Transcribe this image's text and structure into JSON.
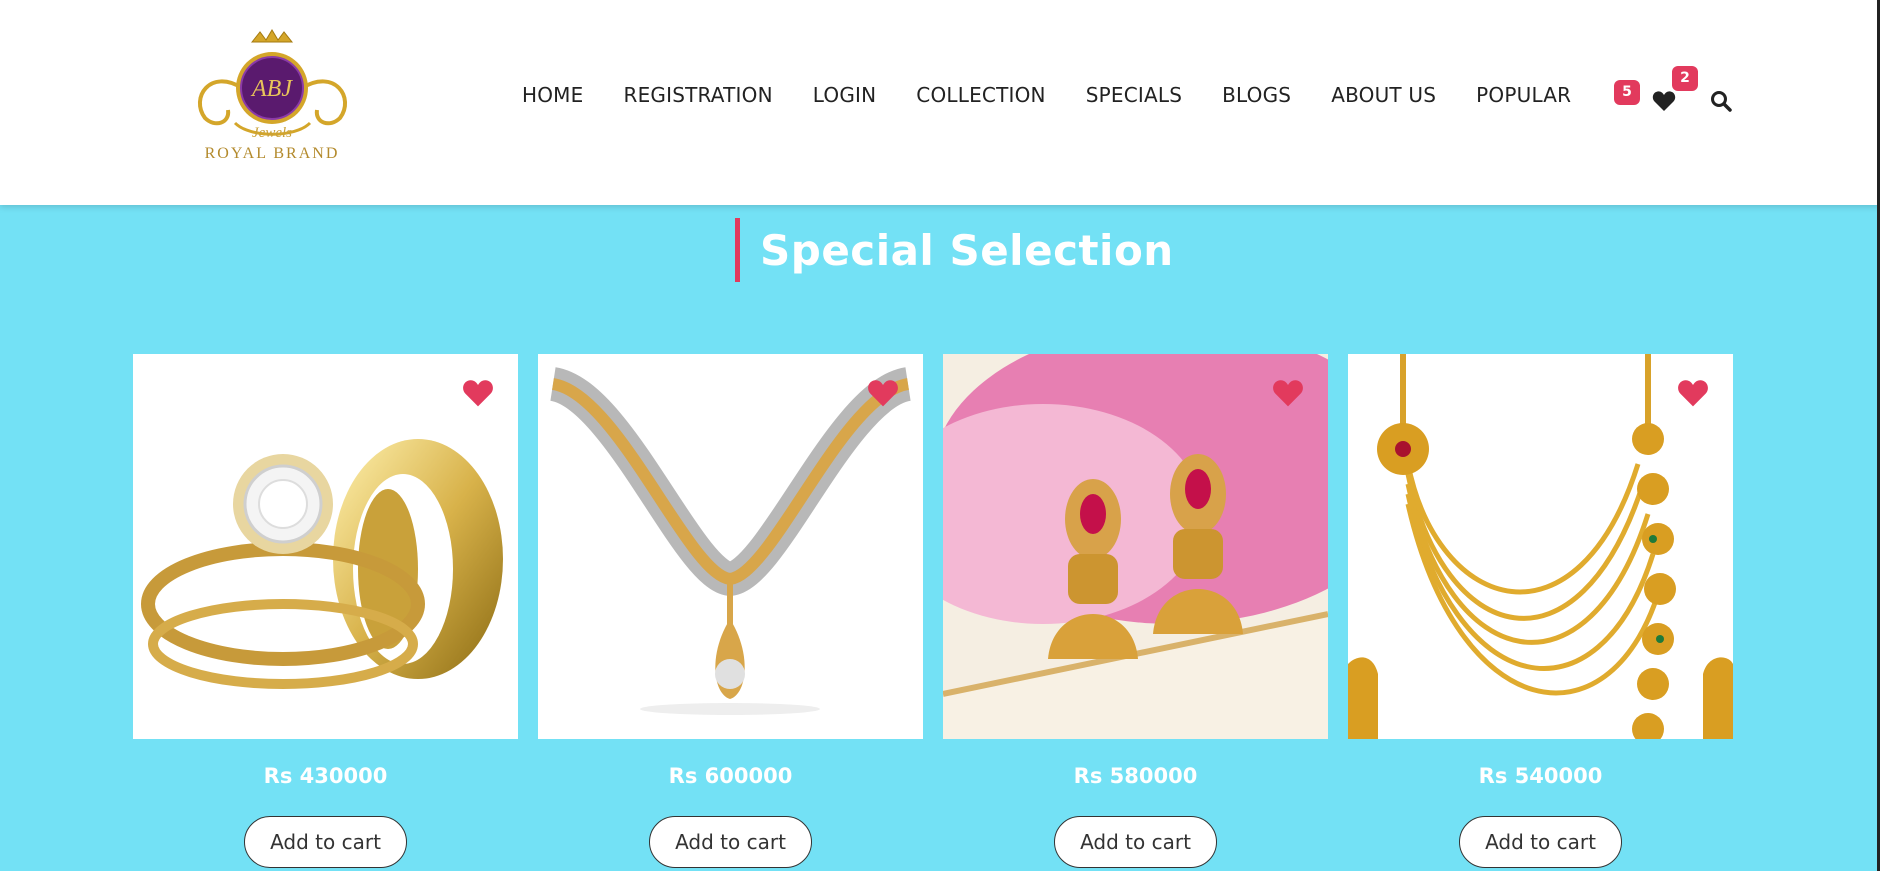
{
  "brand": {
    "logo_monogram": "ABJ",
    "logo_word": "Jewels",
    "logo_name": "ROYAL BRAND"
  },
  "nav": {
    "items": [
      "HOME",
      "REGISTRATION",
      "LOGIN",
      "COLLECTION",
      "SPECIALS",
      "BLOGS",
      "ABOUT US",
      "POPULAR"
    ]
  },
  "header_icons": {
    "cart_count": "5",
    "wishlist_count": "2",
    "wishlist_icon": "heart-icon",
    "search_icon": "search-icon"
  },
  "section": {
    "title": "Special Selection"
  },
  "products": [
    {
      "image": "gold-diamond-rings",
      "price": "Rs 430000",
      "button": "Add to cart"
    },
    {
      "image": "diamond-gold-necklace",
      "price": "Rs 600000",
      "button": "Add to cart"
    },
    {
      "image": "gold-jhumka-earrings",
      "price": "Rs 580000",
      "button": "Add to cart"
    },
    {
      "image": "gold-layered-necklace",
      "price": "Rs 540000",
      "button": "Add to cart"
    }
  ],
  "colors": {
    "accent": "#e23a5d",
    "background": "#73e1f5",
    "gold": "#d4a62a",
    "purple": "#5a1a6e"
  }
}
